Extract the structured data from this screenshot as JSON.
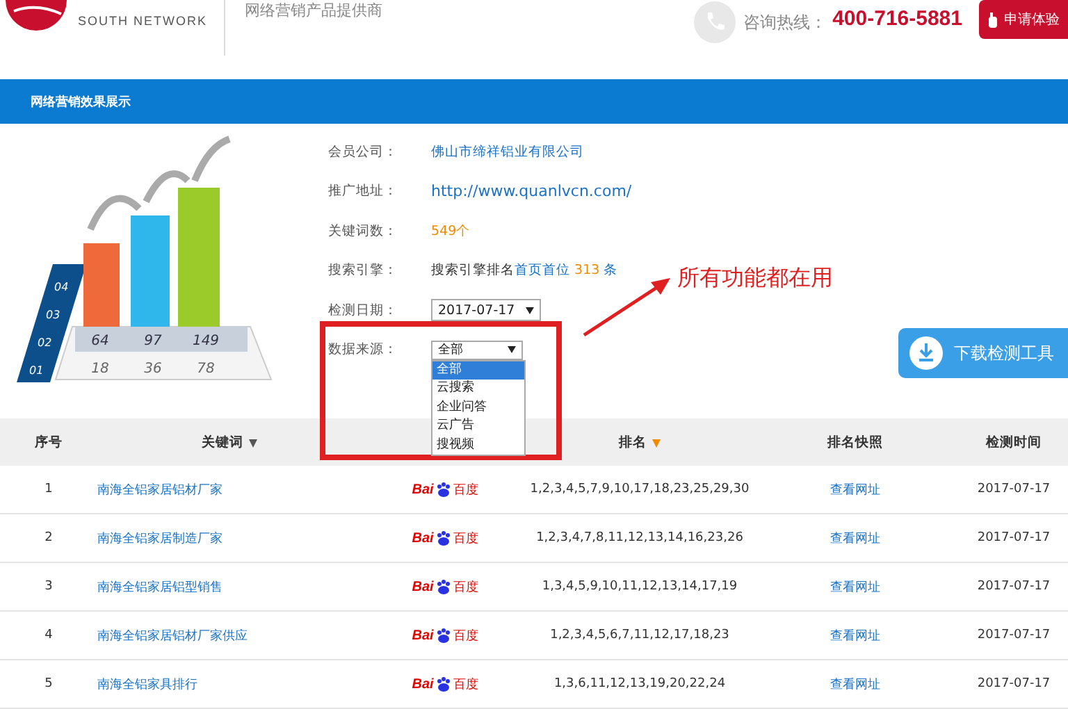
{
  "header": {
    "logo_text": "SOUTH NETWORK",
    "tagline": "网络营销产品提供商",
    "hotline_label": "咨询热线：",
    "hotline_number": "400-716-5881",
    "apply_button": "申请体验"
  },
  "section_title": "网络营销效果展示",
  "illustration": {
    "axis_labels": [
      "04",
      "03",
      "02",
      "01"
    ],
    "upper_values": [
      "64",
      "97",
      "149"
    ],
    "lower_values": [
      "18",
      "36",
      "78"
    ]
  },
  "info": [
    {
      "kind": "text",
      "label": "会员公司：",
      "value": "佛山市缔祥铝业有限公司"
    },
    {
      "kind": "link",
      "label": "推广地址：",
      "value": "http://www.quanlvcn.com/"
    },
    {
      "kind": "count",
      "label": "关键词数：",
      "value": "549个"
    },
    {
      "kind": "engine",
      "label": "搜索引擎：",
      "prefix": "搜索引擎排名",
      "highlight": "首页首位",
      "count": "313",
      "suffix": "条"
    },
    {
      "kind": "select",
      "label": "检测日期：",
      "value": "2017-07-17"
    },
    {
      "kind": "dropdown",
      "label": "数据来源：",
      "value": "全部",
      "options": [
        {
          "label": "全部",
          "selected": true
        },
        {
          "label": "云搜索",
          "selected": false
        },
        {
          "label": "企业问答",
          "selected": false
        },
        {
          "label": "云广告",
          "selected": false
        },
        {
          "label": "搜视频",
          "selected": false
        }
      ]
    }
  ],
  "annotation": "所有功能都在用",
  "download_button": "下载检测工具",
  "table": {
    "columns": [
      {
        "label": "序号",
        "sort": false
      },
      {
        "label": "关键词",
        "sort": true
      },
      {
        "sort": false
      },
      {
        "label": "排名",
        "sort": true
      },
      {
        "label": "排名快照",
        "sort": false
      },
      {
        "label": "检测时间",
        "sort": false
      }
    ],
    "rows": [
      {
        "no": "1",
        "keyword": "南海全铝家居铝材厂家",
        "engine": {
          "latin": "Bai",
          "chinese": "百度"
        },
        "ranks": "1,2,3,4,5,7,9,10,17,18,23,25,29,30",
        "snapshot": "查看网址",
        "date": "2017-07-17"
      },
      {
        "no": "2",
        "keyword": "南海全铝家居制造厂家",
        "engine": {
          "latin": "Bai",
          "chinese": "百度"
        },
        "ranks": "1,2,3,4,7,8,11,12,13,14,16,23,26",
        "snapshot": "查看网址",
        "date": "2017-07-17"
      },
      {
        "no": "3",
        "keyword": "南海全铝家居铝型销售",
        "engine": {
          "latin": "Bai",
          "chinese": "百度"
        },
        "ranks": "1,3,4,5,9,10,11,12,13,14,17,19",
        "snapshot": "查看网址",
        "date": "2017-07-17"
      },
      {
        "no": "4",
        "keyword": "南海全铝家居铝材厂家供应",
        "engine": {
          "latin": "Bai",
          "chinese": "百度"
        },
        "ranks": "1,2,3,4,5,6,7,11,12,17,18,23",
        "snapshot": "查看网址",
        "date": "2017-07-17"
      },
      {
        "no": "5",
        "keyword": "南海全铝家具排行",
        "engine": {
          "latin": "Bai",
          "chinese": "百度"
        },
        "ranks": "1,3,6,11,12,13,19,20,22,24",
        "snapshot": "查看网址",
        "date": "2017-07-17"
      }
    ]
  }
}
